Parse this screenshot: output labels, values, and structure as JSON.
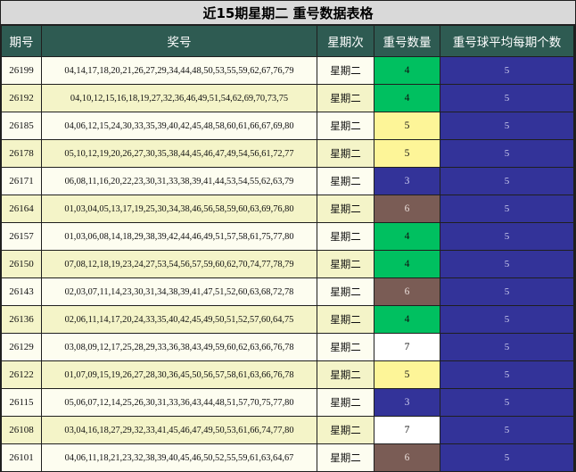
{
  "title": "近15期星期二 重号数据表格",
  "headers": [
    "期号",
    "奖号",
    "星期次",
    "重号数量",
    "重号球平均每期个数"
  ],
  "colors": {
    "header_bg": "#2e5b52",
    "avg_bg": "#333399",
    "count_4": "#00c060",
    "count_5": "#fdf598",
    "count_3": "#333399",
    "count_6": "#7a5c55",
    "count_7": "#ffffff"
  },
  "rows": [
    {
      "period": "26199",
      "numbers": "04,14,17,18,20,21,26,27,29,34,44,48,50,53,55,59,62,67,76,79",
      "day": "星期二",
      "count": "4",
      "avg": "5"
    },
    {
      "period": "26192",
      "numbers": "04,10,12,15,16,18,19,27,32,36,46,49,51,54,62,69,70,73,75",
      "day": "星期二",
      "count": "4",
      "avg": "5"
    },
    {
      "period": "26185",
      "numbers": "04,06,12,15,24,30,33,35,39,40,42,45,48,58,60,61,66,67,69,80",
      "day": "星期二",
      "count": "5",
      "avg": "5"
    },
    {
      "period": "26178",
      "numbers": "05,10,12,19,20,26,27,30,35,38,44,45,46,47,49,54,56,61,72,77",
      "day": "星期二",
      "count": "5",
      "avg": "5"
    },
    {
      "period": "26171",
      "numbers": "06,08,11,16,20,22,23,30,31,33,38,39,41,44,53,54,55,62,63,79",
      "day": "星期二",
      "count": "3",
      "avg": "5"
    },
    {
      "period": "26164",
      "numbers": "01,03,04,05,13,17,19,25,30,34,38,46,56,58,59,60,63,69,76,80",
      "day": "星期二",
      "count": "6",
      "avg": "5"
    },
    {
      "period": "26157",
      "numbers": "01,03,06,08,14,18,29,38,39,42,44,46,49,51,57,58,61,75,77,80",
      "day": "星期二",
      "count": "4",
      "avg": "5"
    },
    {
      "period": "26150",
      "numbers": "07,08,12,18,19,23,24,27,53,54,56,57,59,60,62,70,74,77,78,79",
      "day": "星期二",
      "count": "4",
      "avg": "5"
    },
    {
      "period": "26143",
      "numbers": "02,03,07,11,14,23,30,31,34,38,39,41,47,51,52,60,63,68,72,78",
      "day": "星期二",
      "count": "6",
      "avg": "5"
    },
    {
      "period": "26136",
      "numbers": "02,06,11,14,17,20,24,33,35,40,42,45,49,50,51,52,57,60,64,75",
      "day": "星期二",
      "count": "4",
      "avg": "5"
    },
    {
      "period": "26129",
      "numbers": "03,08,09,12,17,25,28,29,33,36,38,43,49,59,60,62,63,66,76,78",
      "day": "星期二",
      "count": "7",
      "avg": "5"
    },
    {
      "period": "26122",
      "numbers": "01,07,09,15,19,26,27,28,30,36,45,50,56,57,58,61,63,66,76,78",
      "day": "星期二",
      "count": "5",
      "avg": "5"
    },
    {
      "period": "26115",
      "numbers": "05,06,07,12,14,25,26,30,31,33,36,43,44,48,51,57,70,75,77,80",
      "day": "星期二",
      "count": "3",
      "avg": "5"
    },
    {
      "period": "26108",
      "numbers": "03,04,16,18,27,29,32,33,41,45,46,47,49,50,53,61,66,74,77,80",
      "day": "星期二",
      "count": "7",
      "avg": "5"
    },
    {
      "period": "26101",
      "numbers": "04,06,11,18,21,23,32,38,39,40,45,46,50,52,55,59,61,63,64,67",
      "day": "星期二",
      "count": "6",
      "avg": "5"
    }
  ]
}
